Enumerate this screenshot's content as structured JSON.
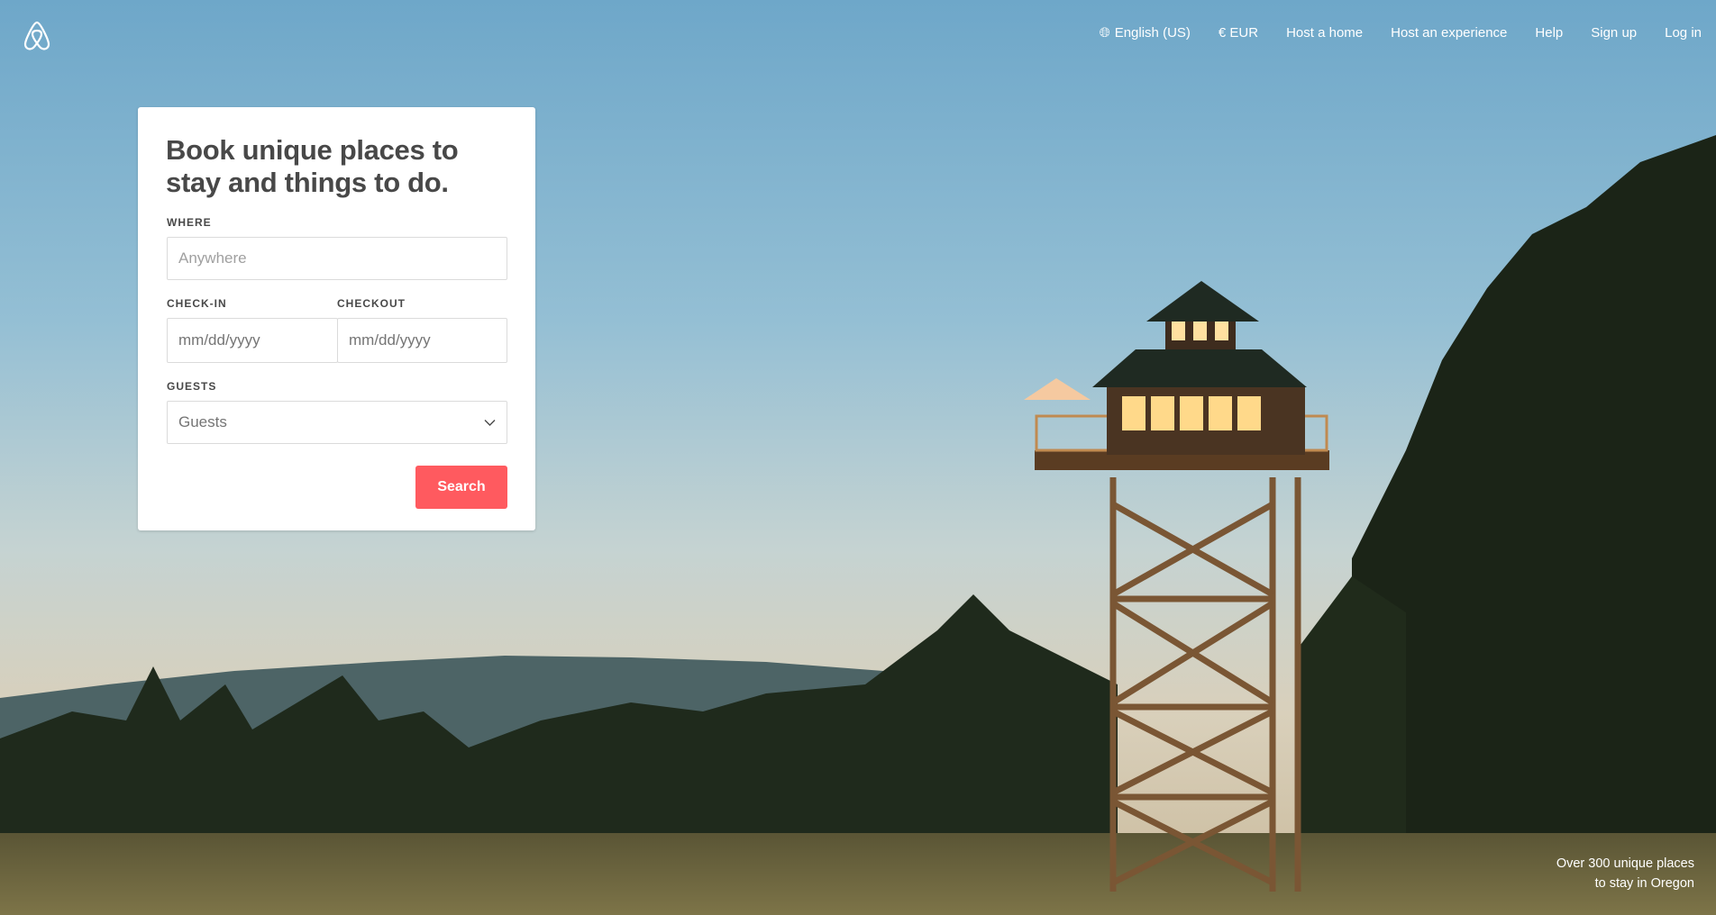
{
  "header": {
    "logo": "airbnb",
    "nav": [
      {
        "label": "English (US)",
        "icon": "globe-icon"
      },
      {
        "label": "€ EUR"
      },
      {
        "label": "Host a home"
      },
      {
        "label": "Host an experience"
      },
      {
        "label": "Help"
      },
      {
        "label": "Sign up"
      },
      {
        "label": "Log in"
      }
    ]
  },
  "search_card": {
    "title": "Book unique places to stay and things to do.",
    "where_label": "WHERE",
    "where_placeholder": "Anywhere",
    "checkin_label": "CHECK-IN",
    "checkin_placeholder": "mm/dd/yyyy",
    "checkout_label": "CHECKOUT",
    "checkout_placeholder": "mm/dd/yyyy",
    "guests_label": "GUESTS",
    "guests_value": "Guests",
    "search_label": "Search"
  },
  "caption": {
    "line1": "Over 300 unique places",
    "line2": "to stay in Oregon"
  },
  "colors": {
    "accent": "#ff5a5f",
    "text": "#484848"
  }
}
